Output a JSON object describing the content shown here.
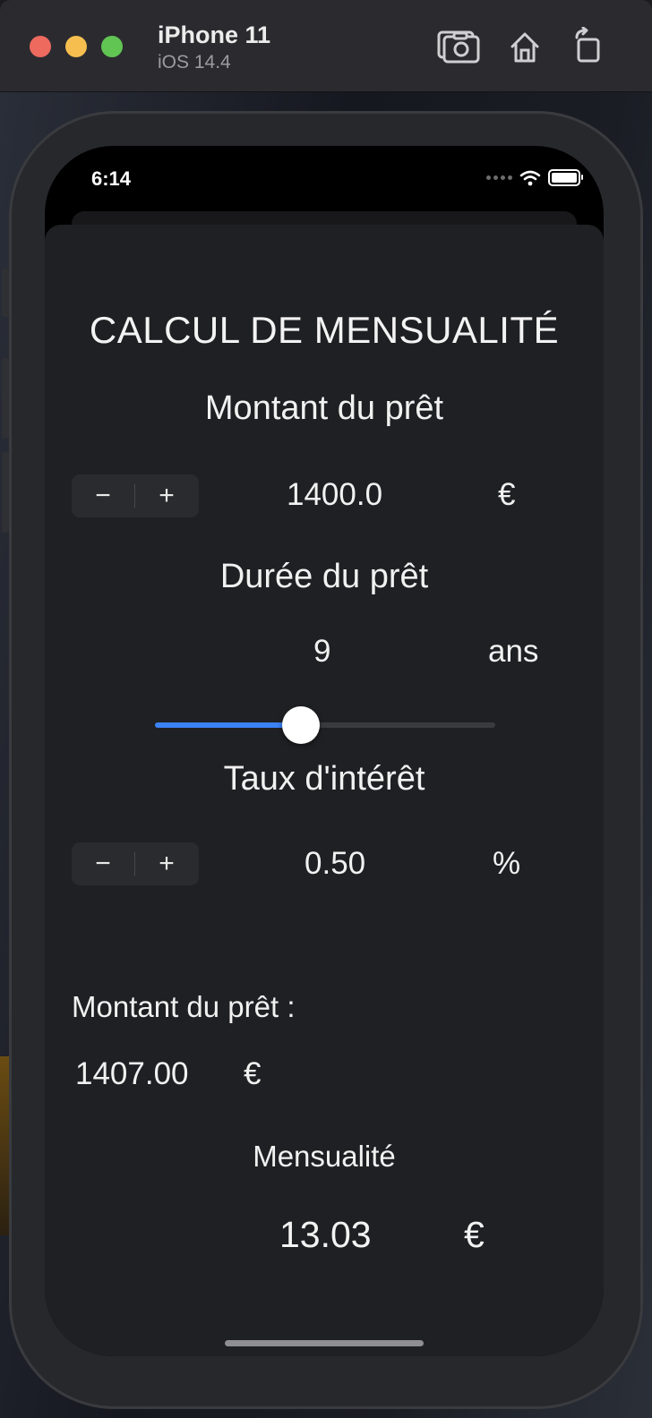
{
  "simulator": {
    "device_name": "iPhone 11",
    "os_version": "iOS 14.4",
    "toolbar": {
      "screenshot_icon": "camera-icon",
      "home_icon": "home-icon",
      "rotate_icon": "rotate-icon"
    }
  },
  "status_bar": {
    "time": "6:14"
  },
  "app": {
    "title": "CALCUL DE MENSUALITÉ",
    "loan_amount": {
      "label": "Montant du prêt",
      "value": "1400.0",
      "unit": "€",
      "stepper_minus": "−",
      "stepper_plus": "+"
    },
    "duration": {
      "label": "Durée du prêt",
      "value": "9",
      "unit": "ans",
      "slider_fraction": 0.43
    },
    "interest": {
      "label": "Taux d'intérêt",
      "value": "0.50",
      "unit": "%",
      "stepper_minus": "−",
      "stepper_plus": "+"
    },
    "total": {
      "label": "Montant du prêt :",
      "value": "1407.00",
      "unit": "€"
    },
    "monthly": {
      "label": "Mensualité",
      "value": "13.03",
      "unit": "€"
    }
  },
  "colors": {
    "accent": "#3b82f6",
    "sheet_background": "#1f2023"
  }
}
